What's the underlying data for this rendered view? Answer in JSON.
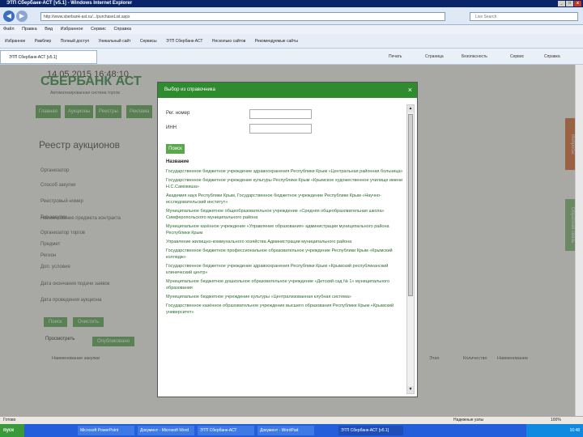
{
  "browser": {
    "title": "ЭТП Сбербанк-АСТ [v5.1] - Windows Internet Explorer",
    "url": "http://www.sberbank-ast.ru/.../purchaseList.aspx",
    "search_placeholder": "Live Search",
    "menu": [
      "Файл",
      "Правка",
      "Вид",
      "Избранное",
      "Сервис",
      "Справка"
    ],
    "favorites": [
      "Избранное",
      "Рамблер",
      "Полный доступ",
      "Уникальный сайт",
      "Сервисы",
      "ЭТП Сбербанк-АСТ",
      "Несколько сайтов",
      "Рекомендуемые сайты"
    ],
    "tab": "ЭТП Сбербанк-АСТ [v5.1]",
    "commands": [
      "Печать",
      "Страница",
      "Безопасность",
      "Сервис",
      "Справка"
    ]
  },
  "page": {
    "datetime": "14.05.2015 16:48:10",
    "logo": "СБЕРБАНК АСТ",
    "logo_sub": "Автоматизированная система торгов",
    "tabs": [
      "Главная",
      "Аукционы",
      "Реестры",
      "Реклама"
    ],
    "heading": "Реестр аукционов",
    "fields": [
      "Организатор",
      "Способ закупки",
      "Реестровый номер",
      "Тип закупки",
      "Наименование предмета контракта",
      "Организатор торгов",
      "Предмет",
      "Регион",
      "Доп. условия",
      "Дата окончания подачи заявок",
      "Дата проведения аукциона"
    ],
    "buttons": [
      "Поиск",
      "Очистить"
    ],
    "lower_tabs": [
      "Просмотреть",
      "Опубликовано"
    ],
    "table_headers": [
      "Наименование закупки",
      "Этап",
      "Количество",
      "Наименование"
    ],
    "ribbons": [
      "Вопросы",
      "Обратная связь"
    ]
  },
  "modal": {
    "title": "Выбор из справочника",
    "close": "×",
    "label_reg": "Рег. номер",
    "label_inn": "ИНН",
    "search_button": "Поиск",
    "results_header": "Название",
    "results": [
      "Государственное бюджетное учреждение здравоохранения Республики Крым «Центральная районная больница»",
      "Государственное бюджетное учреждение культуры Республики Крым «Крымское художественное училище имени Н.С.Самокиша»",
      "Академия наук Республики Крым, Государственное бюджетное учреждение Республики Крым «Научно-исследовательский институт»",
      "Муниципальное бюджетное общеобразовательное учреждение «Средняя общеобразовательная школа» Симферопольского муниципального района",
      "Муниципальное казённое учреждение «Управление образования» администрации муниципального района Республики Крым",
      "Управление жилищно-коммунального хозяйства Администрации муниципального района",
      "Государственное бюджетное профессиональное образовательное учреждение Республики Крым «Крымский колледж»",
      "Государственное бюджетное учреждение здравоохранения Республики Крым «Крымский республиканский клинический центр»",
      "Муниципальное бюджетное дошкольное образовательное учреждение «Детский сад № 1» муниципального образования",
      "Муниципальное бюджетное учреждение культуры «Централизованная клубная система»",
      "Государственное казённое образовательное учреждение высшего образования Республики Крым «Крымский университет»"
    ]
  },
  "status": {
    "text": "Готово",
    "zone": "Надежные узлы",
    "zoom": "100%"
  },
  "taskbar": {
    "start": "пуск",
    "items": [
      "Microsoft PowerPoint",
      "Документ - Microsoft Word",
      "ЭТП Сбербанк-АСТ",
      "Документ - WordPad",
      "ЭТП Сбербанк-АСТ [v5.1]"
    ],
    "clock": "16:48"
  }
}
